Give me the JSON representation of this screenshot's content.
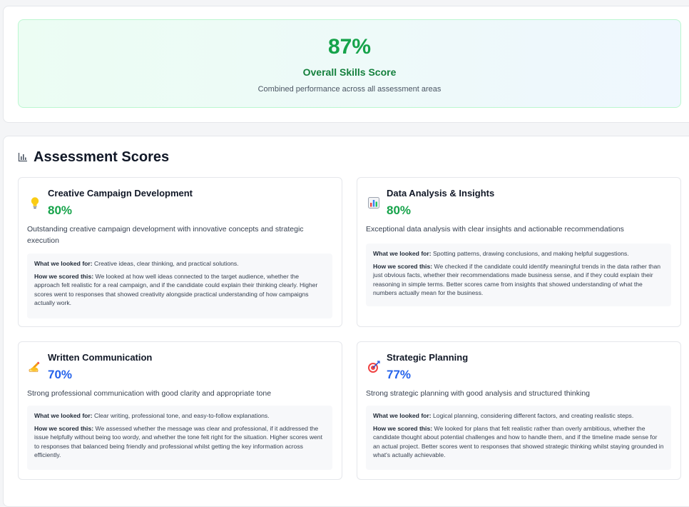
{
  "overall": {
    "score": "87%",
    "label": "Overall Skills Score",
    "description": "Combined performance across all assessment areas"
  },
  "section": {
    "title": "Assessment Scores",
    "icon": "bar-chart-icon"
  },
  "labels": {
    "looked_for": "What we looked for:",
    "scored": "How we scored this:"
  },
  "colors": {
    "high_score": "#16a34a",
    "mid_score": "#2563eb"
  },
  "cards": [
    {
      "title": "Creative Campaign Development",
      "icon": "lightbulb-icon",
      "score": "80%",
      "summary": "Outstanding creative campaign development with innovative concepts and strategic execution",
      "looked_for": "Creative ideas, clear thinking, and practical solutions.",
      "scored": "We looked at how well ideas connected to the target audience, whether the approach felt realistic for a real campaign, and if the candidate could explain their thinking clearly. Higher scores went to responses that showed creativity alongside practical understanding of how campaigns actually work."
    },
    {
      "title": "Data Analysis & Insights",
      "icon": "bar-chart-icon",
      "score": "80%",
      "summary": "Exceptional data analysis with clear insights and actionable recommendations",
      "looked_for": "Spotting patterns, drawing conclusions, and making helpful suggestions.",
      "scored": "We checked if the candidate could identify meaningful trends in the data rather than just obvious facts, whether their recommendations made business sense, and if they could explain their reasoning in simple terms. Better scores came from insights that showed understanding of what the numbers actually mean for the business."
    },
    {
      "title": "Written Communication",
      "icon": "writing-hand-icon",
      "score": "70%",
      "summary": "Strong professional communication with good clarity and appropriate tone",
      "looked_for": "Clear writing, professional tone, and easy-to-follow explanations.",
      "scored": "We assessed whether the message was clear and professional, if it addressed the issue helpfully without being too wordy, and whether the tone felt right for the situation. Higher scores went to responses that balanced being friendly and professional whilst getting the key information across efficiently."
    },
    {
      "title": "Strategic Planning",
      "icon": "target-icon",
      "score": "77%",
      "summary": "Strong strategic planning with good analysis and structured thinking",
      "looked_for": "Logical planning, considering different factors, and creating realistic steps.",
      "scored": "We looked for plans that felt realistic rather than overly ambitious, whether the candidate thought about potential challenges and how to handle them, and if the timeline made sense for an actual project. Better scores went to responses that showed strategic thinking whilst staying grounded in what's actually achievable."
    }
  ]
}
